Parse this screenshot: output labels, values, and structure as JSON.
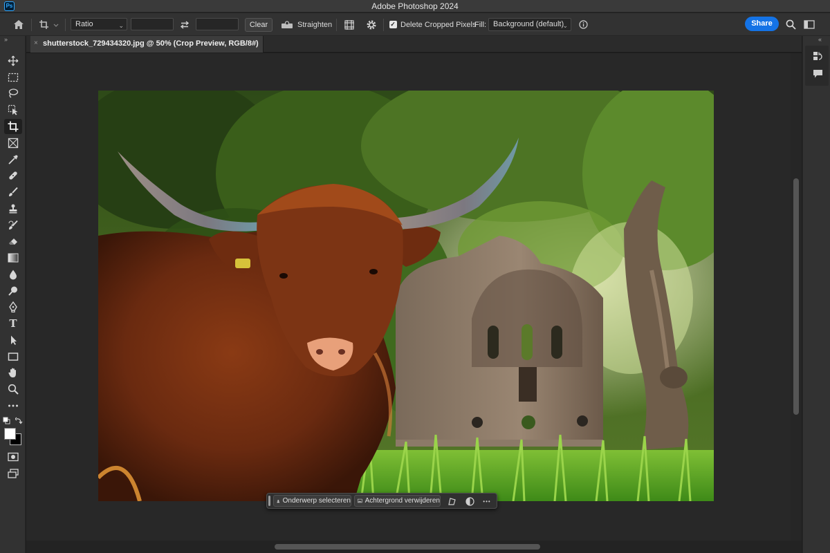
{
  "app": {
    "logo_text": "Ps",
    "title": "Adobe Photoshop 2024"
  },
  "options_bar": {
    "ratio_label": "Ratio",
    "clear_label": "Clear",
    "straighten_label": "Straighten",
    "delete_cropped_label": "Delete Cropped Pixels",
    "delete_cropped_checked": true,
    "fill_label": "Fill:",
    "fill_value": "Background (default)",
    "share_label": "Share"
  },
  "document": {
    "tab_title": "shutterstock_729434320.jpg @ 50% (Crop Preview, RGB/8#)",
    "close_glyph": "×"
  },
  "tools": [
    "move-tool",
    "marquee-tool",
    "lasso-tool",
    "object-selection-tool",
    "crop-tool",
    "frame-tool",
    "eyedropper-tool",
    "healing-brush-tool",
    "brush-tool",
    "clone-stamp-tool",
    "history-brush-tool",
    "eraser-tool",
    "gradient-tool",
    "blur-tool",
    "dodge-tool",
    "pen-tool",
    "type-tool",
    "path-selection-tool",
    "rectangle-tool",
    "hand-tool",
    "zoom-tool",
    "more-tools"
  ],
  "active_tool": "crop-tool",
  "type_tool_glyph": "T",
  "context_bar": {
    "select_subject_label": "Onderwerp selecteren",
    "remove_background_label": "Achtergrond verwijderen",
    "more_glyph": "•••"
  },
  "colors": {
    "accent": "#1473e6",
    "foreground_swatch": "#ffffff",
    "background_swatch": "#000000"
  }
}
